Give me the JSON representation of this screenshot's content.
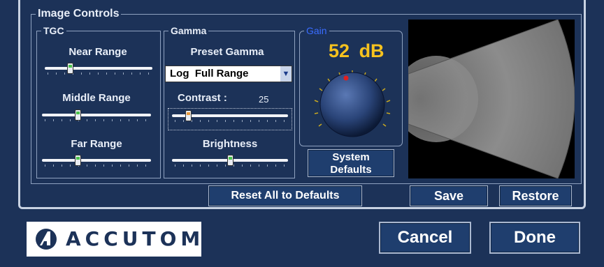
{
  "panel": {
    "title": "Image Controls"
  },
  "tgc": {
    "title": "TGC",
    "sliders": [
      {
        "label": "Near Range",
        "value": 0.22
      },
      {
        "label": "Middle Range",
        "value": 0.32
      },
      {
        "label": "Far Range",
        "value": 0.32
      }
    ]
  },
  "gamma": {
    "title": "Gamma",
    "preset_label": "Preset Gamma",
    "preset_value": "Log  Full Range",
    "contrast_label": "Contrast :",
    "contrast_value": "25",
    "contrast_level": 0.12,
    "brightness_label": "Brightness",
    "brightness_level": 0.5
  },
  "gain": {
    "title": "Gain",
    "value": "52",
    "unit": "dB",
    "title_color": "#3a6cff",
    "value_color": "#f6c21e"
  },
  "buttons": {
    "system_defaults": "System Defaults",
    "reset_all": "Reset All to Defaults",
    "save": "Save",
    "restore": "Restore",
    "cancel": "Cancel",
    "done": "Done"
  },
  "logo": {
    "text": "ACCUTOME"
  }
}
